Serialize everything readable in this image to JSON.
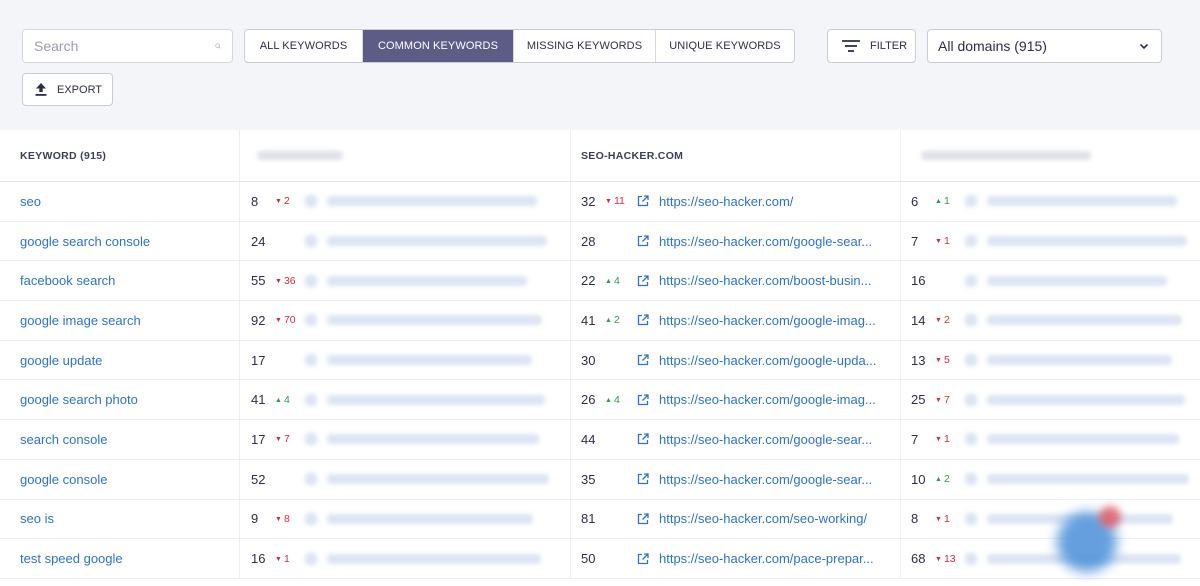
{
  "search": {
    "placeholder": "Search"
  },
  "tabs": [
    {
      "label": "ALL KEYWORDS",
      "active": false
    },
    {
      "label": "COMMON KEYWORDS",
      "active": true
    },
    {
      "label": "MISSING KEYWORDS",
      "active": false
    },
    {
      "label": "UNIQUE KEYWORDS",
      "active": false
    }
  ],
  "filter": {
    "label": "FILTER"
  },
  "domain_select": {
    "value": "All domains (915)"
  },
  "export": {
    "label": "EXPORT"
  },
  "table": {
    "columns": {
      "keyword": "KEYWORD (915)",
      "domain2": "SEO-HACKER.COM"
    },
    "rows": [
      {
        "keyword": "seo",
        "d1_pos": "8",
        "d1_chg": "2",
        "d1_dir": "down",
        "d2_pos": "32",
        "d2_chg": "11",
        "d2_dir": "down",
        "d2_url": "https://seo-hacker.com/",
        "d3_pos": "6",
        "d3_chg": "1",
        "d3_dir": "up"
      },
      {
        "keyword": "google search console",
        "d1_pos": "24",
        "d1_chg": "",
        "d1_dir": "",
        "d2_pos": "28",
        "d2_chg": "",
        "d2_dir": "",
        "d2_url": "https://seo-hacker.com/google-sear...",
        "d3_pos": "7",
        "d3_chg": "1",
        "d3_dir": "down"
      },
      {
        "keyword": "facebook search",
        "d1_pos": "55",
        "d1_chg": "36",
        "d1_dir": "down",
        "d2_pos": "22",
        "d2_chg": "4",
        "d2_dir": "up",
        "d2_url": "https://seo-hacker.com/boost-busin...",
        "d3_pos": "16",
        "d3_chg": "",
        "d3_dir": ""
      },
      {
        "keyword": "google image search",
        "d1_pos": "92",
        "d1_chg": "70",
        "d1_dir": "down",
        "d2_pos": "41",
        "d2_chg": "2",
        "d2_dir": "up",
        "d2_url": "https://seo-hacker.com/google-imag...",
        "d3_pos": "14",
        "d3_chg": "2",
        "d3_dir": "down"
      },
      {
        "keyword": "google update",
        "d1_pos": "17",
        "d1_chg": "",
        "d1_dir": "",
        "d2_pos": "30",
        "d2_chg": "",
        "d2_dir": "",
        "d2_url": "https://seo-hacker.com/google-upda...",
        "d3_pos": "13",
        "d3_chg": "5",
        "d3_dir": "down"
      },
      {
        "keyword": "google search photo",
        "d1_pos": "41",
        "d1_chg": "4",
        "d1_dir": "up",
        "d2_pos": "26",
        "d2_chg": "4",
        "d2_dir": "up",
        "d2_url": "https://seo-hacker.com/google-imag...",
        "d3_pos": "25",
        "d3_chg": "7",
        "d3_dir": "down"
      },
      {
        "keyword": "search console",
        "d1_pos": "17",
        "d1_chg": "7",
        "d1_dir": "down",
        "d2_pos": "44",
        "d2_chg": "",
        "d2_dir": "",
        "d2_url": "https://seo-hacker.com/google-sear...",
        "d3_pos": "7",
        "d3_chg": "1",
        "d3_dir": "down"
      },
      {
        "keyword": "google console",
        "d1_pos": "52",
        "d1_chg": "",
        "d1_dir": "",
        "d2_pos": "35",
        "d2_chg": "",
        "d2_dir": "",
        "d2_url": "https://seo-hacker.com/google-sear...",
        "d3_pos": "10",
        "d3_chg": "2",
        "d3_dir": "up"
      },
      {
        "keyword": "seo is",
        "d1_pos": "9",
        "d1_chg": "8",
        "d1_dir": "down",
        "d2_pos": "81",
        "d2_chg": "",
        "d2_dir": "",
        "d2_url": "https://seo-hacker.com/seo-working/",
        "d3_pos": "8",
        "d3_chg": "1",
        "d3_dir": "down"
      },
      {
        "keyword": "test speed google",
        "d1_pos": "16",
        "d1_chg": "1",
        "d1_dir": "down",
        "d2_pos": "50",
        "d2_chg": "",
        "d2_dir": "",
        "d2_url": "https://seo-hacker.com/pace-prepar...",
        "d3_pos": "68",
        "d3_chg": "13",
        "d3_dir": "down"
      }
    ]
  },
  "colors": {
    "accent": "#5d5c87",
    "link": "#2e73c9",
    "down": "#d82b3a",
    "up": "#2d9a4d"
  },
  "icons": [
    "search-icon",
    "filter-icon",
    "chevron-down-icon",
    "export-icon",
    "external-link-icon",
    "chat-bubble-icon"
  ]
}
